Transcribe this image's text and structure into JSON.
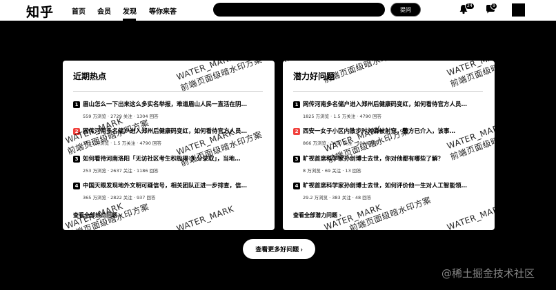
{
  "header": {
    "logo": "知乎",
    "nav": [
      "首页",
      "会员",
      "发现",
      "等你来答"
    ],
    "search_placeholder": "",
    "ask_label": "提问",
    "notification_badge": "24",
    "message_badge": "9"
  },
  "cards": [
    {
      "title": "近期热点",
      "items": [
        {
          "rank": "1",
          "title": "眉山怎么一下出来这么多实名举报，难道眉山人民一直活在阴…",
          "meta": "559 万浏览 · 2729 关注 · 1304 回答"
        },
        {
          "rank": "2",
          "title": "网传河南多名储户进入郑州后健康码变红，如何看待官方人员…",
          "meta": "1825 万浏览 · 1.5 万关注 · 4790 回答"
        },
        {
          "rank": "3",
          "title": "如何看待河南洛阳「无访社区考生积极得 3 分录取」，当地…",
          "meta": "253 万浏览 · 2637 关注 · 1186 回答"
        },
        {
          "rank": "4",
          "title": "中国天眼发现地外文明可疑信号，相关团队正进一步排查，信…",
          "meta": "365 万浏览 · 2822 关注 · 937 回答"
        }
      ],
      "view_all": "查看全部热点问题 ›"
    },
    {
      "title": "潜力好问题",
      "items": [
        {
          "rank": "1",
          "title": "网传河南多名储户进入郑州后健康码变红，如何看待官方人员…",
          "meta": "1825 万浏览 · 1.5 万关注 · 4790 回答"
        },
        {
          "rank": "2",
          "title": "西安一女子小区内散步时刘海被射穿，警方已介入，该事…",
          "meta": "866 万浏览 · 3460 关注 · 1004 回答"
        },
        {
          "rank": "3",
          "title": "旷视首席科学家孙剑博士去世，你对他都有哪些了解？",
          "meta": "8 万浏览 · 69 关注 · 13 回答"
        },
        {
          "rank": "4",
          "title": "旷视首席科学家孙剑博士去世，如何评价他一生对人工智能领…",
          "meta": "29.2 万浏览 · 383 关注 · 48 回答"
        }
      ],
      "view_all": "查看全部潜力问题 ›"
    }
  ],
  "watermark": {
    "en": "WATER_MARK",
    "zh": "前端页面级暗水印方案"
  },
  "more_button": "查看更多好问题 ›",
  "footer_watermark": "@稀土掘金技术社区"
}
